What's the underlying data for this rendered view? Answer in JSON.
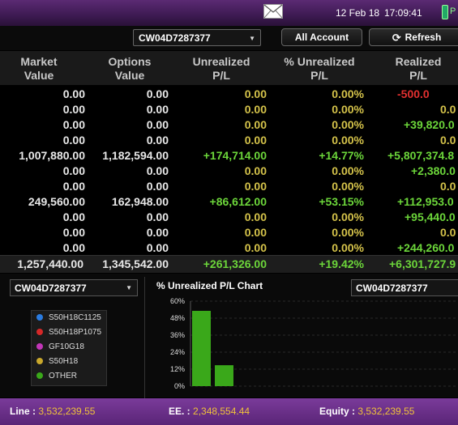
{
  "topbar": {
    "date": "12 Feb 18",
    "time": "17:09:41",
    "status_text": "P"
  },
  "toolbar": {
    "account": "CW04D7287377",
    "all_account_label": "All Account",
    "refresh_label": "Refresh"
  },
  "grid": {
    "headers": [
      {
        "line1": "Market",
        "line2": "Value"
      },
      {
        "line1": "Options",
        "line2": "Value"
      },
      {
        "line1": "Unrealized",
        "line2": "P/L"
      },
      {
        "line1": "% Unrealized",
        "line2": "P/L"
      },
      {
        "line1": "Realized",
        "line2": "P/L"
      }
    ],
    "rows": [
      [
        "0.00",
        "0.00",
        "0.00",
        "0.00%",
        "-500.0"
      ],
      [
        "0.00",
        "0.00",
        "0.00",
        "0.00%",
        "0.0"
      ],
      [
        "0.00",
        "0.00",
        "0.00",
        "0.00%",
        "+39,820.0"
      ],
      [
        "0.00",
        "0.00",
        "0.00",
        "0.00%",
        "0.0"
      ],
      [
        "1,007,880.00",
        "1,182,594.00",
        "+174,714.00",
        "+14.77%",
        "+5,807,374.8"
      ],
      [
        "0.00",
        "0.00",
        "0.00",
        "0.00%",
        "+2,380.0"
      ],
      [
        "0.00",
        "0.00",
        "0.00",
        "0.00%",
        "0.0"
      ],
      [
        "249,560.00",
        "162,948.00",
        "+86,612.00",
        "+53.15%",
        "+112,953.0"
      ],
      [
        "0.00",
        "0.00",
        "0.00",
        "0.00%",
        "+95,440.0"
      ],
      [
        "0.00",
        "0.00",
        "0.00",
        "0.00%",
        "0.0"
      ],
      [
        "0.00",
        "0.00",
        "0.00",
        "0.00%",
        "+244,260.0"
      ]
    ],
    "total": [
      "1,257,440.00",
      "1,345,542.00",
      "+261,326.00",
      "+19.42%",
      "+6,301,727.9"
    ]
  },
  "lower": {
    "left_select": "CW04D7287377",
    "right_select": "CW04D7287377",
    "legend": [
      {
        "label": "S50H18C1125",
        "color": "#2a7be0"
      },
      {
        "label": "S50H18P1075",
        "color": "#d62828"
      },
      {
        "label": "GF10G18",
        "color": "#c236b8"
      },
      {
        "label": "S50H18",
        "color": "#c9a82c"
      },
      {
        "label": "OTHER",
        "color": "#3aa81a"
      }
    ]
  },
  "chart_data": {
    "type": "bar",
    "title": "% Unrealized P/L Chart",
    "yticks": [
      "60%",
      "48%",
      "36%",
      "24%",
      "12%",
      "0%"
    ],
    "ylim": [
      0,
      60
    ],
    "values": [
      53.15,
      14.77
    ],
    "color": "#3aa81a",
    "grid": true
  },
  "footer": {
    "line_label": "Line :",
    "line_value": "3,532,239.55",
    "ee_label": "EE. :",
    "ee_value": "2,348,554.44",
    "equity_label": "Equity :",
    "equity_value": "3,532,239.55"
  }
}
